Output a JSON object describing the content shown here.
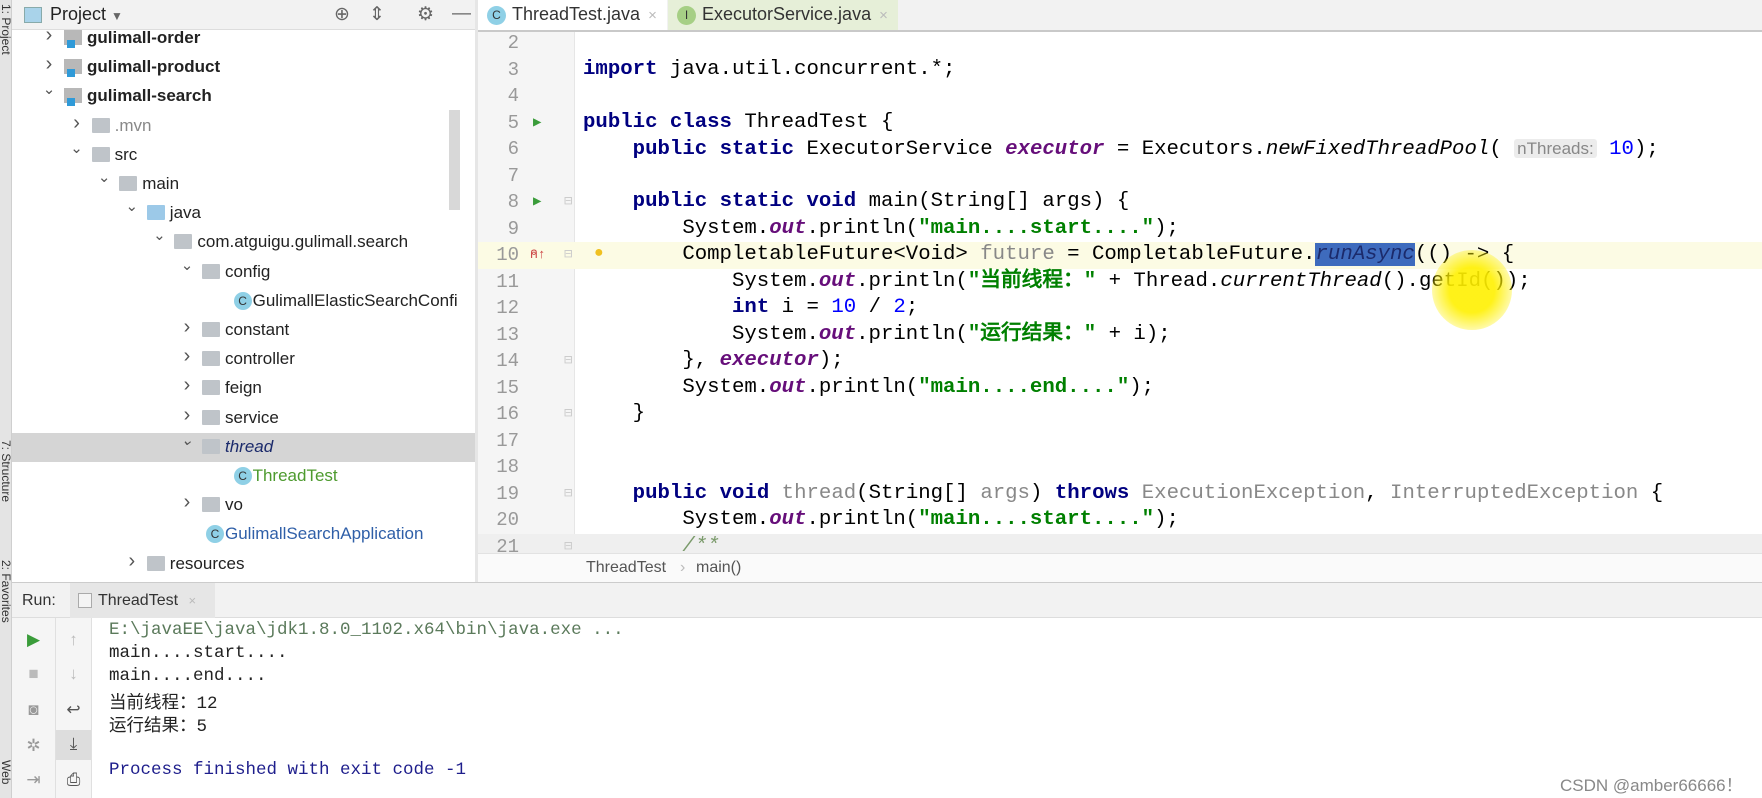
{
  "side_strip": {
    "labels": [
      "1: Project",
      "7: Structure",
      "2: Favorites",
      "Web"
    ]
  },
  "project": {
    "title": "Project",
    "tree": [
      {
        "level": 0,
        "label": "gulimall-order",
        "type": "module",
        "chevron": "right",
        "bold": true
      },
      {
        "level": 0,
        "label": "gulimall-product",
        "type": "module",
        "chevron": "right",
        "bold": true
      },
      {
        "level": 0,
        "label": "gulimall-search",
        "type": "module",
        "chevron": "down",
        "bold": true
      },
      {
        "level": 1,
        "label": ".mvn",
        "type": "folder",
        "chevron": "right",
        "color": "#888888"
      },
      {
        "level": 1,
        "label": "src",
        "type": "folder",
        "chevron": "down"
      },
      {
        "level": 2,
        "label": "main",
        "type": "folder",
        "chevron": "down"
      },
      {
        "level": 3,
        "label": "java",
        "type": "folder-blue",
        "chevron": "down"
      },
      {
        "level": 4,
        "label": "com.atguigu.gulimall.search",
        "type": "package",
        "chevron": "down"
      },
      {
        "level": 5,
        "label": "config",
        "type": "package",
        "chevron": "down"
      },
      {
        "level": 6,
        "label": "GulimallElasticSearchConfi",
        "type": "class"
      },
      {
        "level": 5,
        "label": "constant",
        "type": "package",
        "chevron": "right"
      },
      {
        "level": 5,
        "label": "controller",
        "type": "package",
        "chevron": "right"
      },
      {
        "level": 5,
        "label": "feign",
        "type": "package",
        "chevron": "right"
      },
      {
        "level": 5,
        "label": "service",
        "type": "package",
        "chevron": "right"
      },
      {
        "level": 5,
        "label": "thread",
        "type": "package",
        "chevron": "down",
        "selected": true
      },
      {
        "level": 6,
        "label": "ThreadTest",
        "type": "class",
        "color": "#4d9a2e"
      },
      {
        "level": 5,
        "label": "vo",
        "type": "package",
        "chevron": "right"
      },
      {
        "level": 5,
        "label": "GulimallSearchApplication",
        "type": "class",
        "color": "#2f5fa8"
      },
      {
        "level": 3,
        "label": "resources",
        "type": "folder",
        "chevron": "right"
      }
    ]
  },
  "editor": {
    "tabs": [
      {
        "label": "ThreadTest.java",
        "icon": "C",
        "active": true,
        "bg": "#ffffff"
      },
      {
        "label": "ExecutorService.java",
        "icon": "I",
        "bg": "#e6efd8"
      }
    ],
    "current_line": 10,
    "lines": [
      {
        "n": 2,
        "tokens": []
      },
      {
        "n": 3,
        "tokens": [
          {
            "t": "import ",
            "c": "k"
          },
          {
            "t": "java.util.concurrent.*;"
          }
        ]
      },
      {
        "n": 4,
        "tokens": []
      },
      {
        "n": 5,
        "run": true,
        "tokens": [
          {
            "t": "public class ",
            "c": "k"
          },
          {
            "t": "ThreadTest {"
          }
        ]
      },
      {
        "n": 6,
        "tokens": [
          {
            "t": "    "
          },
          {
            "t": "public static ",
            "c": "k"
          },
          {
            "t": "ExecutorService "
          },
          {
            "t": "executor",
            "c": "f"
          },
          {
            "t": " = Executors."
          },
          {
            "t": "newFixedThreadPool",
            "c": "i"
          },
          {
            "t": "( "
          },
          {
            "t": "nThreads:",
            "c": "h"
          },
          {
            "t": " "
          },
          {
            "t": "10",
            "c": "n"
          },
          {
            "t": ");"
          }
        ]
      },
      {
        "n": 7,
        "tokens": []
      },
      {
        "n": 8,
        "run": true,
        "fold": true,
        "tokens": [
          {
            "t": "    "
          },
          {
            "t": "public static void ",
            "c": "k"
          },
          {
            "t": "main(String[] args) {"
          }
        ]
      },
      {
        "n": 9,
        "tokens": [
          {
            "t": "        System."
          },
          {
            "t": "out",
            "c": "f"
          },
          {
            "t": ".println("
          },
          {
            "t": "\"main....start....\"",
            "c": "s"
          },
          {
            "t": ");"
          }
        ]
      },
      {
        "n": 10,
        "override": true,
        "bulb": true,
        "fold": true,
        "tokens": [
          {
            "t": "        CompletableFuture<Void> "
          },
          {
            "t": "future",
            "c": "g"
          },
          {
            "t": " = CompletableFuture."
          },
          {
            "t": "runAsync",
            "c": "sel"
          },
          {
            "t": "(() -> {"
          }
        ]
      },
      {
        "n": 11,
        "tokens": [
          {
            "t": "            System."
          },
          {
            "t": "out",
            "c": "f"
          },
          {
            "t": ".println("
          },
          {
            "t": "\"当前线程：\"",
            "c": "s"
          },
          {
            "t": " + Thread."
          },
          {
            "t": "currentThread",
            "c": "i"
          },
          {
            "t": "().getId());"
          }
        ]
      },
      {
        "n": 12,
        "tokens": [
          {
            "t": "            "
          },
          {
            "t": "int ",
            "c": "k"
          },
          {
            "t": "i = "
          },
          {
            "t": "10",
            "c": "n"
          },
          {
            "t": " / "
          },
          {
            "t": "2",
            "c": "n"
          },
          {
            "t": ";"
          }
        ]
      },
      {
        "n": 13,
        "tokens": [
          {
            "t": "            System."
          },
          {
            "t": "out",
            "c": "f"
          },
          {
            "t": ".println("
          },
          {
            "t": "\"运行结果：\"",
            "c": "s"
          },
          {
            "t": " + i);"
          }
        ]
      },
      {
        "n": 14,
        "fold": true,
        "tokens": [
          {
            "t": "        }, "
          },
          {
            "t": "executor",
            "c": "f"
          },
          {
            "t": ");"
          }
        ]
      },
      {
        "n": 15,
        "tokens": [
          {
            "t": "        System."
          },
          {
            "t": "out",
            "c": "f"
          },
          {
            "t": ".println("
          },
          {
            "t": "\"main....end....\"",
            "c": "s"
          },
          {
            "t": ");"
          }
        ]
      },
      {
        "n": 16,
        "fold": true,
        "tokens": [
          {
            "t": "    }"
          }
        ]
      },
      {
        "n": 17,
        "tokens": []
      },
      {
        "n": 18,
        "tokens": []
      },
      {
        "n": 19,
        "fold": true,
        "tokens": [
          {
            "t": "    "
          },
          {
            "t": "public void ",
            "c": "k"
          },
          {
            "t": "thread",
            "c": "g"
          },
          {
            "t": "(String[] "
          },
          {
            "t": "args",
            "c": "g"
          },
          {
            "t": ") "
          },
          {
            "t": "throws ",
            "c": "k"
          },
          {
            "t": "ExecutionException",
            "c": "g"
          },
          {
            "t": ", "
          },
          {
            "t": "InterruptedException",
            "c": "g"
          },
          {
            "t": " {"
          }
        ]
      },
      {
        "n": 20,
        "tokens": [
          {
            "t": "        System."
          },
          {
            "t": "out",
            "c": "f"
          },
          {
            "t": ".println("
          },
          {
            "t": "\"main....start....\"",
            "c": "s"
          },
          {
            "t": ");"
          }
        ]
      },
      {
        "n": 21,
        "fold": true,
        "gray": true,
        "tokens": [
          {
            "t": "        "
          },
          {
            "t": "/**",
            "c": "c"
          }
        ]
      }
    ],
    "breadcrumb": [
      "ThreadTest",
      "main()"
    ]
  },
  "run": {
    "label": "Run:",
    "tab": "ThreadTest",
    "console": [
      {
        "text": "E:\\javaEE\\java\\jdk1.8.0_1102.x64\\bin\\java.exe ...",
        "color": "#5b7a5b"
      },
      {
        "text": "main....start...."
      },
      {
        "text": "main....end...."
      },
      {
        "text": "当前线程：12"
      },
      {
        "text": "运行结果：5"
      },
      {
        "text": ""
      },
      {
        "text": "Process finished with exit code -1",
        "color": "#1e1e8c"
      }
    ]
  },
  "watermark": "CSDN @amber66666！"
}
